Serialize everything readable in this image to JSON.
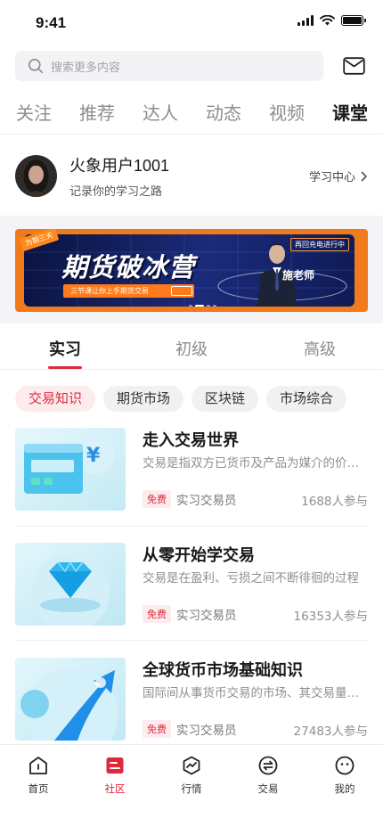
{
  "status_bar": {
    "time": "9:41"
  },
  "search": {
    "placeholder": "搜索更多内容"
  },
  "top_tabs": [
    {
      "label": "关注",
      "active": false
    },
    {
      "label": "推荐",
      "active": false
    },
    {
      "label": "达人",
      "active": false
    },
    {
      "label": "动态",
      "active": false
    },
    {
      "label": "视频",
      "active": false
    },
    {
      "label": "课堂",
      "active": true
    }
  ],
  "profile": {
    "name": "火象用户1001",
    "subtitle": "记录你的学习之路",
    "study_center": "学习中心"
  },
  "banner": {
    "tag": "为期三天",
    "title": "期货破冰营",
    "subtitle": "三节课让你上手期货交易",
    "live": "再回充电进行中",
    "teacher": "施老师",
    "slide_index": 2,
    "slide_count": 4
  },
  "level_tabs": [
    {
      "label": "实习",
      "active": true
    },
    {
      "label": "初级",
      "active": false
    },
    {
      "label": "高级",
      "active": false
    }
  ],
  "chips": [
    {
      "label": "交易知识",
      "active": true
    },
    {
      "label": "期货市场",
      "active": false
    },
    {
      "label": "区块链",
      "active": false
    },
    {
      "label": "市场综合",
      "active": false
    }
  ],
  "courses": [
    {
      "title": "走入交易世界",
      "desc": "交易是指双方已货币及产品为媒介的价值交换",
      "badge": "免费",
      "role": "实习交易员",
      "count": "1688人参与",
      "thumb_icon": "card-yen-icon"
    },
    {
      "title": "从零开始学交易",
      "desc": "交易是在盈利、亏损之间不断徘徊的过程",
      "badge": "免费",
      "role": "实习交易员",
      "count": "16353人参与",
      "thumb_icon": "diamond-icon"
    },
    {
      "title": "全球货币市场基础知识",
      "desc": "国际间从事货币交易的市场、其交易量巨大",
      "badge": "免费",
      "role": "实习交易员",
      "count": "27483人参与",
      "thumb_icon": "globe-arrow-icon"
    }
  ],
  "bottom_nav": [
    {
      "label": "首页",
      "icon": "home-icon",
      "active": false
    },
    {
      "label": "社区",
      "icon": "community-icon",
      "active": true
    },
    {
      "label": "行情",
      "icon": "market-icon",
      "active": false
    },
    {
      "label": "交易",
      "icon": "trade-icon",
      "active": false
    },
    {
      "label": "我的",
      "icon": "profile-icon",
      "active": false
    }
  ],
  "colors": {
    "accent": "#e0283a",
    "banner_orange": "#f07a1c",
    "banner_navy": "#1b2b7a"
  }
}
